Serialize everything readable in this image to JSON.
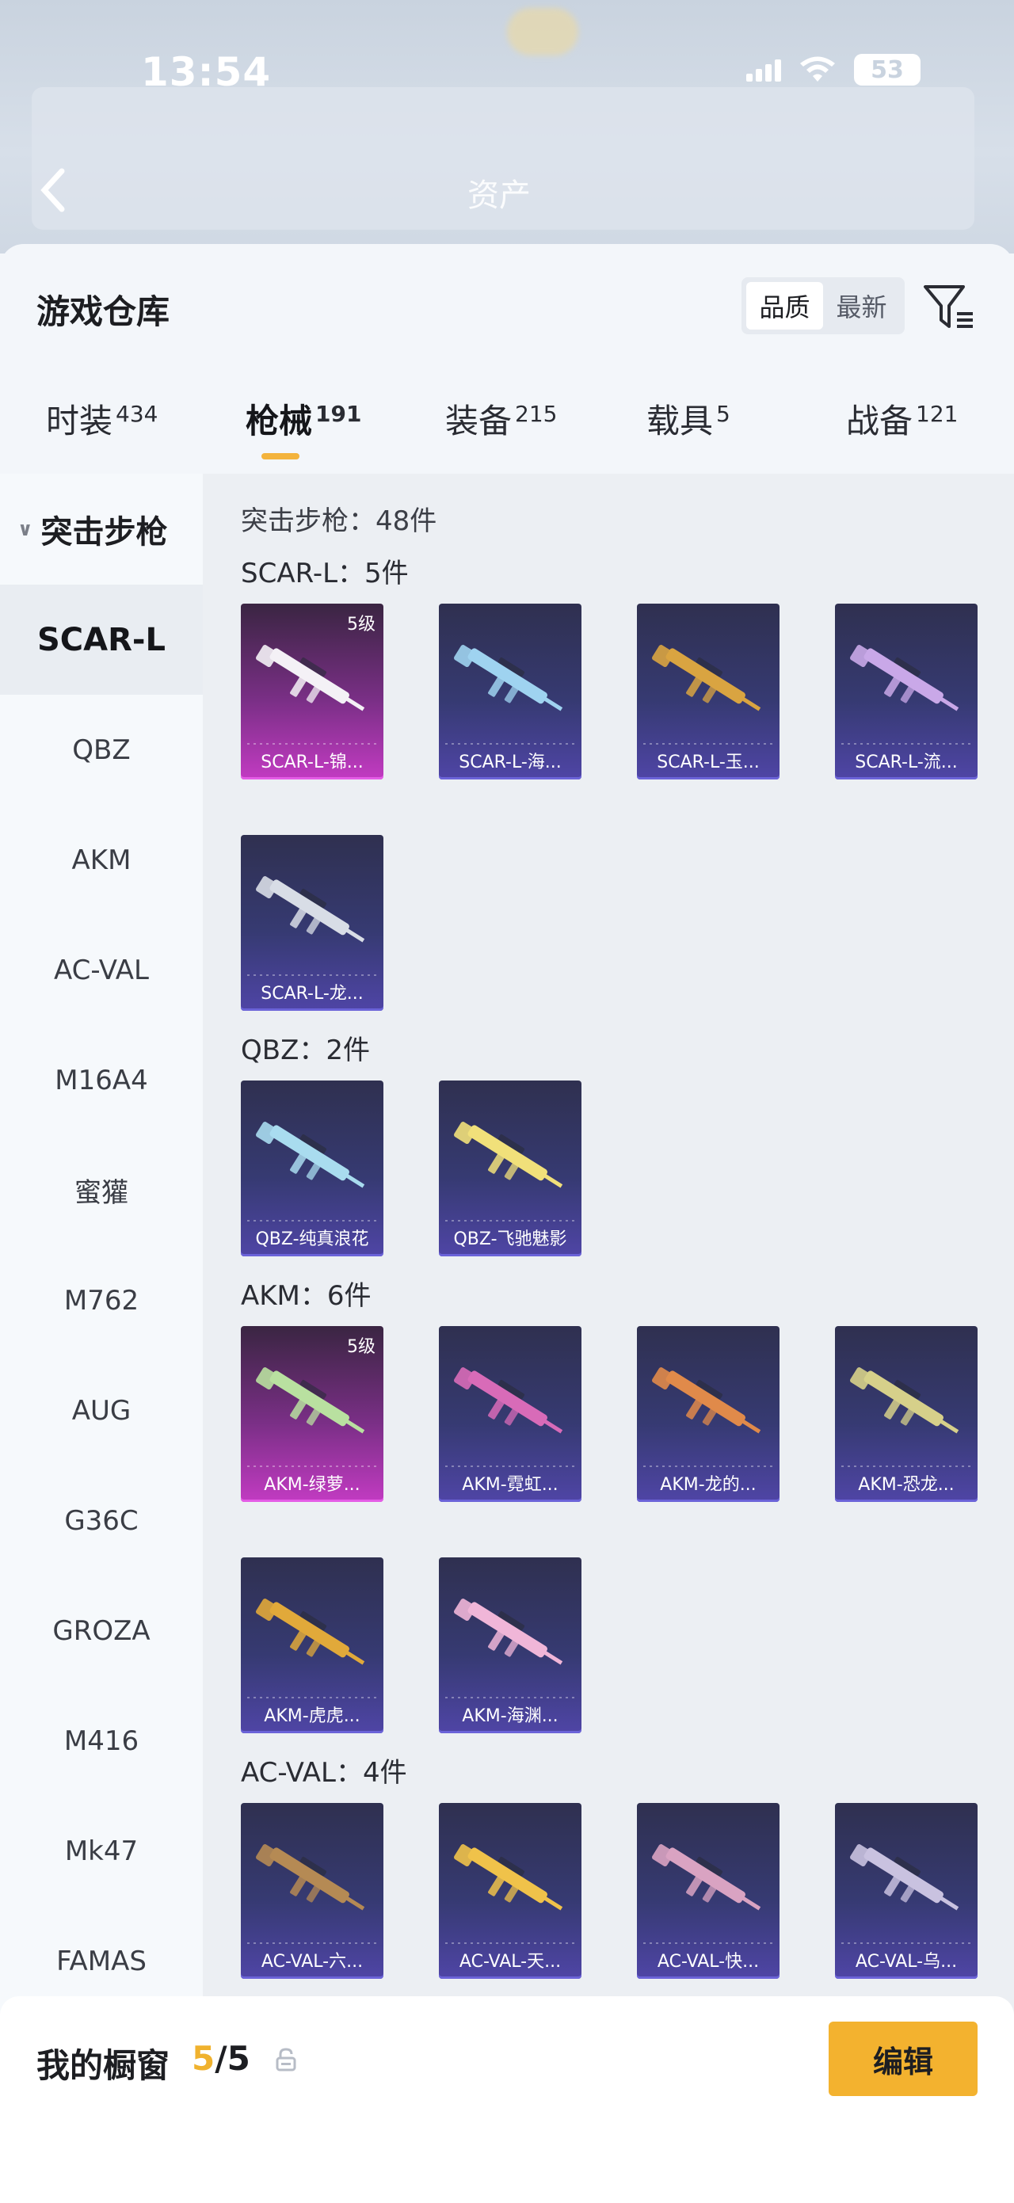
{
  "status": {
    "time": "13:54",
    "battery": "53"
  },
  "blurred_title": "资产",
  "sheet": {
    "title": "游戏仓库",
    "sort_options": [
      "品质",
      "最新"
    ],
    "active_sort": "品质"
  },
  "tabs": [
    {
      "label": "时装",
      "count": "434"
    },
    {
      "label": "枪械",
      "count": "191"
    },
    {
      "label": "装备",
      "count": "215"
    },
    {
      "label": "载具",
      "count": "5"
    },
    {
      "label": "战备",
      "count": "121"
    }
  ],
  "sidebar": {
    "category": "突击步枪",
    "items": [
      "SCAR-L",
      "QBZ",
      "AKM",
      "AC-VAL",
      "M16A4",
      "蜜獾",
      "M762",
      "AUG",
      "G36C",
      "GROZA",
      "M416",
      "Mk47",
      "FAMAS"
    ]
  },
  "content": {
    "total": "突击步枪：48件",
    "groups": [
      {
        "title": "SCAR-L：5件",
        "items": [
          {
            "name": "SCAR-L-锦...",
            "level": "5级",
            "rarity": "purple",
            "color": "#f4f1f6"
          },
          {
            "name": "SCAR-L-海...",
            "level": "",
            "rarity": "blue",
            "color": "#9fd3f0"
          },
          {
            "name": "SCAR-L-玉...",
            "level": "",
            "rarity": "blue",
            "color": "#d9a441"
          },
          {
            "name": "SCAR-L-流...",
            "level": "",
            "rarity": "blue",
            "color": "#c9a8e8"
          },
          {
            "name": "SCAR-L-龙...",
            "level": "",
            "rarity": "blue",
            "color": "#d8dde6"
          }
        ]
      },
      {
        "title": "QBZ：2件",
        "items": [
          {
            "name": "QBZ-纯真浪花",
            "level": "",
            "rarity": "blue",
            "color": "#a9dcef"
          },
          {
            "name": "QBZ-飞驰魅影",
            "level": "",
            "rarity": "blue",
            "color": "#f1e07a"
          }
        ]
      },
      {
        "title": "AKM：6件",
        "items": [
          {
            "name": "AKM-绿萝...",
            "level": "5级",
            "rarity": "purple",
            "color": "#b9e0a0"
          },
          {
            "name": "AKM-霓虹...",
            "level": "",
            "rarity": "blue",
            "color": "#d86bb8"
          },
          {
            "name": "AKM-龙的...",
            "level": "",
            "rarity": "blue",
            "color": "#e08a4a"
          },
          {
            "name": "AKM-恐龙...",
            "level": "",
            "rarity": "blue",
            "color": "#d6d08a"
          },
          {
            "name": "AKM-虎虎...",
            "level": "",
            "rarity": "blue",
            "color": "#e1a93a"
          },
          {
            "name": "AKM-海渊...",
            "level": "",
            "rarity": "blue",
            "color": "#f0b6d8"
          }
        ]
      },
      {
        "title": "AC-VAL：4件",
        "items": [
          {
            "name": "AC-VAL-六...",
            "level": "",
            "rarity": "blue",
            "color": "#b58a54"
          },
          {
            "name": "AC-VAL-天...",
            "level": "",
            "rarity": "blue",
            "color": "#f0c24a"
          },
          {
            "name": "AC-VAL-快...",
            "level": "",
            "rarity": "blue",
            "color": "#d9a3c2"
          },
          {
            "name": "AC-VAL-乌...",
            "level": "",
            "rarity": "blue",
            "color": "#c9c2e0"
          }
        ]
      }
    ]
  },
  "showcase": {
    "title": "我的橱窗",
    "current": "5",
    "max": "/5",
    "edit_label": "编辑"
  },
  "colors": {
    "accent": "#f3b22f",
    "rare_blue": "#4f45a6",
    "rare_purple": "#c23bc2"
  }
}
